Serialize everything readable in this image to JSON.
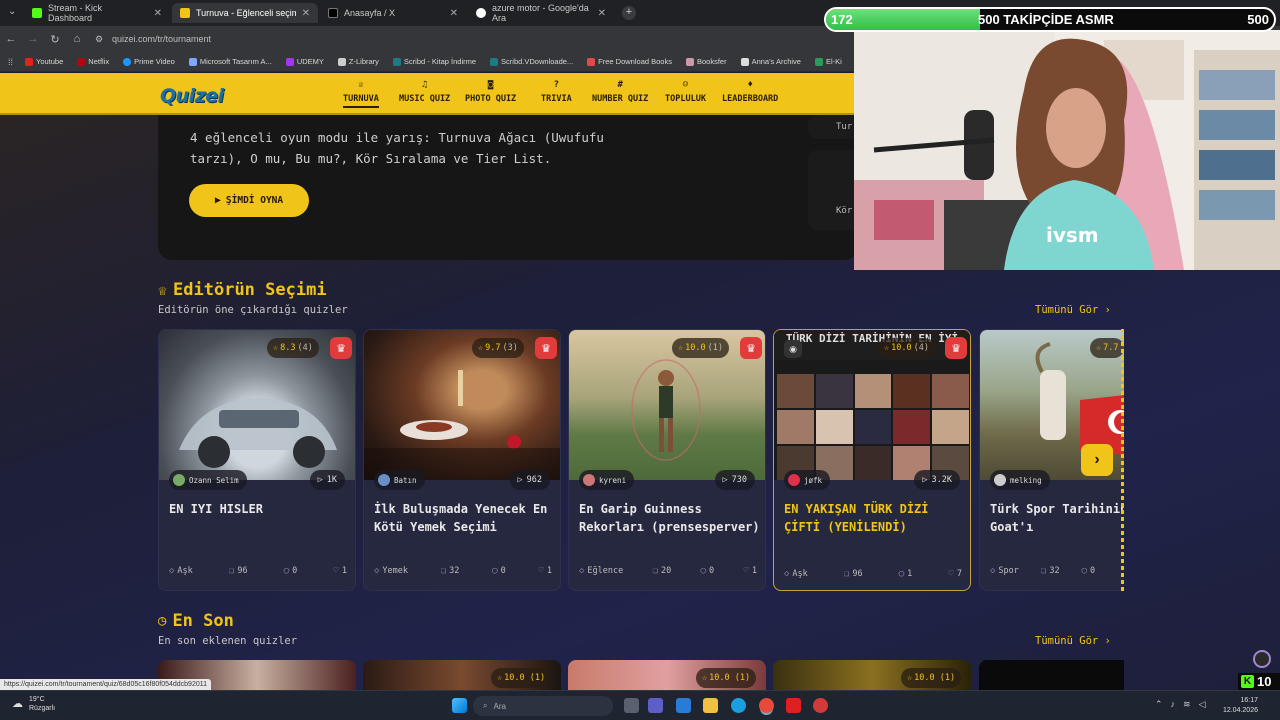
{
  "browser": {
    "tabs": [
      {
        "title": "Stream - Kick Dashboard",
        "color": "#53fc18"
      },
      {
        "title": "Turnuva - Eğlenceli seçimler ya...",
        "color": "#f0c419"
      },
      {
        "title": "Anasayfa / X",
        "color": "#ffffff"
      },
      {
        "title": "azure motor - Google'da Ara",
        "color": "#4285f4"
      }
    ],
    "url": "quizei.com/tr/tournament",
    "bookmarks": [
      "Youtube",
      "Netflix",
      "Prime Video",
      "Microsoft Tasarım A...",
      "UDEMY",
      "Z-Library",
      "Scribd - Kitap İndirme",
      "Scribd.VDownloade...",
      "Free Download Books",
      "Booksfer",
      "Anna's Archive",
      "El-Ki"
    ]
  },
  "site": {
    "logo": "Quizei",
    "nav": [
      {
        "label": "TURNUVA",
        "icon": "♕",
        "active": true
      },
      {
        "label": "MUSIC QUIZ",
        "icon": "♫"
      },
      {
        "label": "PHOTO QUIZ",
        "icon": "◙"
      },
      {
        "label": "TRIVIA",
        "icon": "?"
      },
      {
        "label": "NUMBER QUIZ",
        "icon": "#"
      },
      {
        "label": "TOPLULUK",
        "icon": "☺"
      },
      {
        "label": "LEADERBOARD",
        "icon": "♦"
      }
    ]
  },
  "hero": {
    "text": "4 eğlenceli oyun modu ile yarış: Turnuva Ağacı (Uwufufu tarzı), O mu, Bu mu?, Kör Sıralama ve Tier List.",
    "play_button": "ŞİMDİ OYNA",
    "side_card_1": "Tur",
    "side_card_2": "Kör"
  },
  "editors": {
    "title": "Editörün Seçimi",
    "subtitle": "Editörün öne çıkardığı quizler",
    "see_all": "Tümünü Gör",
    "cards": [
      {
        "rating": "8.3",
        "reviews": "(4)",
        "author": "Ozann Selim",
        "plays": "1K",
        "title": "EN IYI HISLER",
        "category": "Aşk",
        "questions": "96",
        "comments": "0",
        "likes": "1"
      },
      {
        "rating": "9.7",
        "reviews": "(3)",
        "author": "Batın",
        "plays": "962",
        "title": "İlk Buluşmada Yenecek En Kötü Yemek Seçimi",
        "category": "Yemek",
        "questions": "32",
        "comments": "0",
        "likes": "1"
      },
      {
        "rating": "10.0",
        "reviews": "(1)",
        "author": "kyreni",
        "plays": "730",
        "title": "En Garip Guinness Rekorları (prensesperver)",
        "category": "Eğlence",
        "questions": "20",
        "comments": "0",
        "likes": "1"
      },
      {
        "rating": "10.0",
        "reviews": "(4)",
        "author": "jøfk",
        "plays": "3.2K",
        "title": "EN YAKIŞAN TÜRK DİZİ ÇİFTİ (YENİLENDİ)",
        "category": "Aşk",
        "questions": "96",
        "comments": "1",
        "likes": "7",
        "image_caption": "TÜRK DİZİ TARİHİNİN EN İYİ"
      },
      {
        "rating": "7.7",
        "reviews": "",
        "author": "melking",
        "plays": "",
        "title": "Türk Spor Tarihinin Goat'ı",
        "category": "Spor",
        "questions": "32",
        "comments": "0",
        "likes": ""
      }
    ]
  },
  "latest": {
    "title": "En Son",
    "subtitle": "En son eklenen quizler",
    "see_all": "Tümünü Gör",
    "ratings": [
      "",
      "10.0 (1)",
      "10.0 (1)",
      "10.0 (1)",
      ""
    ]
  },
  "status_link": "https://quizei.com/tr/tournament/quiz/68d05c16f80f054ddcb92011",
  "taskbar": {
    "temperature": "19°C",
    "weather": "Rüzgarlı",
    "search": "Ara",
    "time": "16:17",
    "date": "12.04.2026"
  },
  "stream": {
    "goal_current": "172",
    "goal_label": "500 TAKİPÇİDE ASMR",
    "goal_target": "500",
    "goal_progress": 0.344,
    "viewers": "10",
    "shirt_text": "ivsm"
  }
}
